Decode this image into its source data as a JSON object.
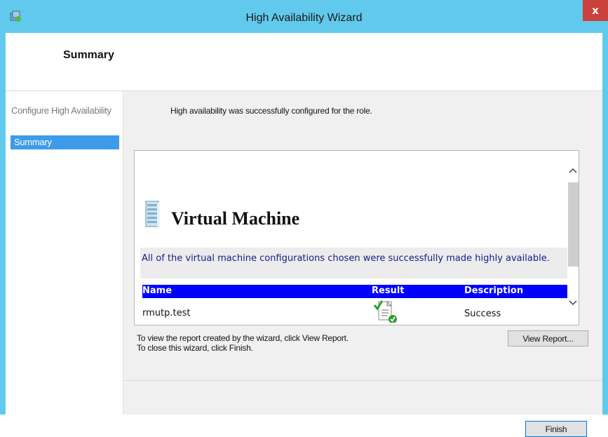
{
  "window": {
    "title": "High Availability Wizard",
    "close_label": "x",
    "accent_color": "#61caec"
  },
  "header": {
    "title": "Summary"
  },
  "nav": {
    "items": [
      {
        "label": "Configure High Availability",
        "selected": false
      },
      {
        "label": "Summary",
        "selected": true
      }
    ]
  },
  "main": {
    "message": "High availability was successfully configured for the role.",
    "report": {
      "heading": "Virtual Machine",
      "description": "All of the virtual machine configurations chosen were successfully made highly available.",
      "columns": [
        "Name",
        "Result",
        "Description"
      ],
      "rows": [
        {
          "name": "rmutp.test",
          "result_icon": "success-report-icon",
          "description": "Success"
        }
      ]
    },
    "info_line1": "To view the report created by the wizard, click View Report.",
    "info_line2": "To close this wizard, click Finish.",
    "view_report_label": "View Report...",
    "finish_label": "Finish"
  }
}
